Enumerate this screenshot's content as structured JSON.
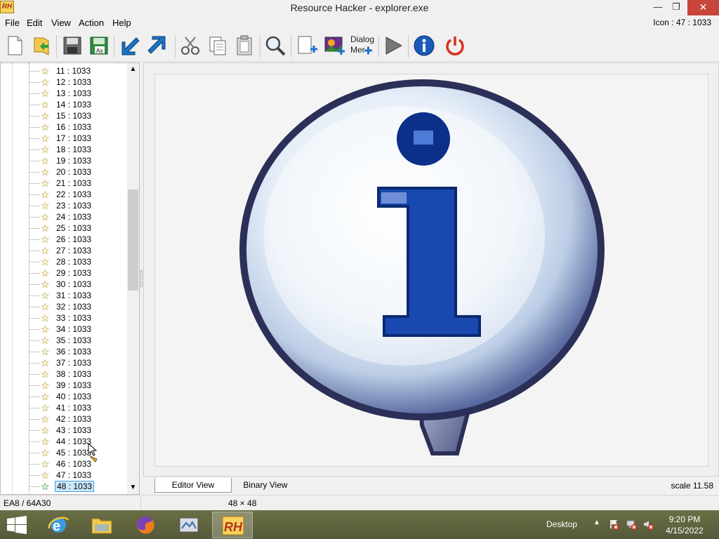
{
  "window": {
    "app_icon_text": "RH",
    "title": "Resource Hacker - explorer.exe",
    "minimize": "—",
    "maximize": "❐",
    "close": "✕"
  },
  "menu": {
    "items": [
      "File",
      "Edit",
      "View",
      "Action",
      "Help"
    ],
    "status_right": "Icon : 47 : 1033"
  },
  "toolbar": {
    "buttons": [
      "new-file-icon",
      "open-file-icon",
      "save-icon",
      "save-as-icon",
      "compile-import-icon",
      "export-icon",
      "cut-icon",
      "copy-icon",
      "paste-icon",
      "find-icon",
      "add-resource-icon",
      "add-image-icon",
      "dialog-merge-icon",
      "run-script-icon",
      "about-icon",
      "exit-icon"
    ],
    "save_as_label": "As",
    "dialog_label_1": "Dialog",
    "dialog_label_2": "Mer"
  },
  "tree": {
    "items": [
      "11 : 1033",
      "12 : 1033",
      "13 : 1033",
      "14 : 1033",
      "15 : 1033",
      "16 : 1033",
      "17 : 1033",
      "18 : 1033",
      "19 : 1033",
      "20 : 1033",
      "21 : 1033",
      "22 : 1033",
      "23 : 1033",
      "24 : 1033",
      "25 : 1033",
      "26 : 1033",
      "27 : 1033",
      "28 : 1033",
      "29 : 1033",
      "30 : 1033",
      "31 : 1033",
      "32 : 1033",
      "33 : 1033",
      "34 : 1033",
      "35 : 1033",
      "36 : 1033",
      "37 : 1033",
      "38 : 1033",
      "39 : 1033",
      "40 : 1033",
      "41 : 1033",
      "42 : 1033",
      "43 : 1033",
      "44 : 1033",
      "45 : 1033",
      "46 : 1033",
      "47 : 1033",
      "48 : 1033"
    ],
    "selected_index": 37
  },
  "view": {
    "tab_editor": "Editor View",
    "tab_binary": "Binary View",
    "scale": "scale 11.58",
    "image_content": "info-balloon-icon"
  },
  "statusbar": {
    "left": "EA8 / 64A30",
    "dims": "48 × 48"
  },
  "taskbar": {
    "apps": [
      "internet-explorer-icon",
      "file-explorer-icon",
      "firefox-icon",
      "system-tool-icon",
      "resource-hacker-icon"
    ],
    "active_app": "resource-hacker-icon",
    "active_label": "RH",
    "desktop_label": "Desktop",
    "tray_arrow": "▲",
    "time": "9:20 PM",
    "date": "4/15/2022"
  },
  "colors": {
    "accent_blue": "#1a73c9",
    "exit_red": "#d9301c",
    "taskbar": "#5a5e3a",
    "selection": "#cce8ff"
  }
}
